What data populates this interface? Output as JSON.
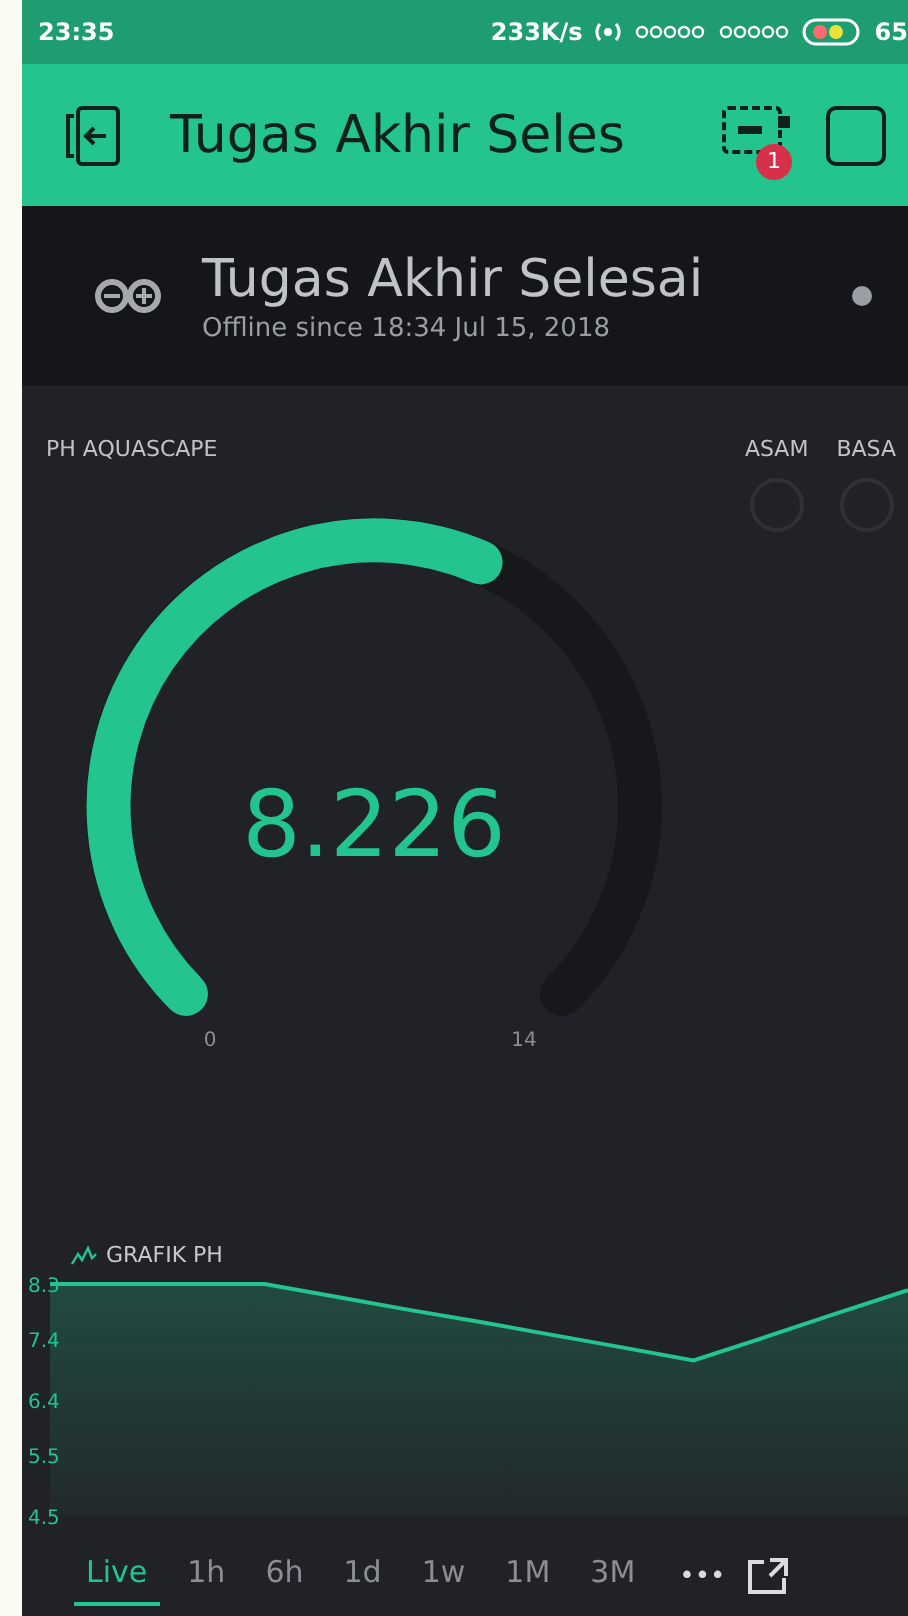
{
  "status_bar": {
    "time": "23:35",
    "speed": "233K/s",
    "battery": "65"
  },
  "header": {
    "title": "Tugas Akhir Seles",
    "badge": "1"
  },
  "device": {
    "name": "Tugas Akhir Selesai",
    "status": "Offline since 18:34 Jul 15, 2018",
    "online": false
  },
  "gauge": {
    "label": "PH AQUASCAPE",
    "value": "8.226",
    "min": "0",
    "max": "14"
  },
  "leds": [
    {
      "label": "ASAM",
      "on": false
    },
    {
      "label": "BASA",
      "on": false
    }
  ],
  "chart": {
    "title": "GRAFIK PH",
    "chart_data": {
      "type": "line",
      "categories": [
        null,
        null,
        null,
        null,
        null,
        null,
        null,
        null,
        null,
        null,
        null,
        null,
        null
      ],
      "ylim": [
        4.5,
        8.3
      ],
      "yticks": [
        {
          "value": 4.5,
          "label": "4.5"
        },
        {
          "value": 5.5,
          "label": "5.5"
        },
        {
          "value": 6.4,
          "label": "6.4"
        },
        {
          "value": 7.4,
          "label": "7.4"
        },
        {
          "value": 8.3,
          "label": "8.3"
        }
      ],
      "series": [
        {
          "color": "#23c48e",
          "values": [
            8.3,
            8.3,
            8.3,
            8.3,
            8.09,
            7.88,
            7.68,
            7.47,
            7.26,
            7.05,
            7.43,
            7.82,
            8.2
          ]
        }
      ]
    }
  },
  "ranges": [
    {
      "label": "Live",
      "selected": true
    },
    {
      "label": "1h",
      "selected": false
    },
    {
      "label": "6h",
      "selected": false
    },
    {
      "label": "1d",
      "selected": false
    },
    {
      "label": "1w",
      "selected": false
    },
    {
      "label": "1M",
      "selected": false
    },
    {
      "label": "3M",
      "selected": false
    }
  ],
  "more": "•••"
}
